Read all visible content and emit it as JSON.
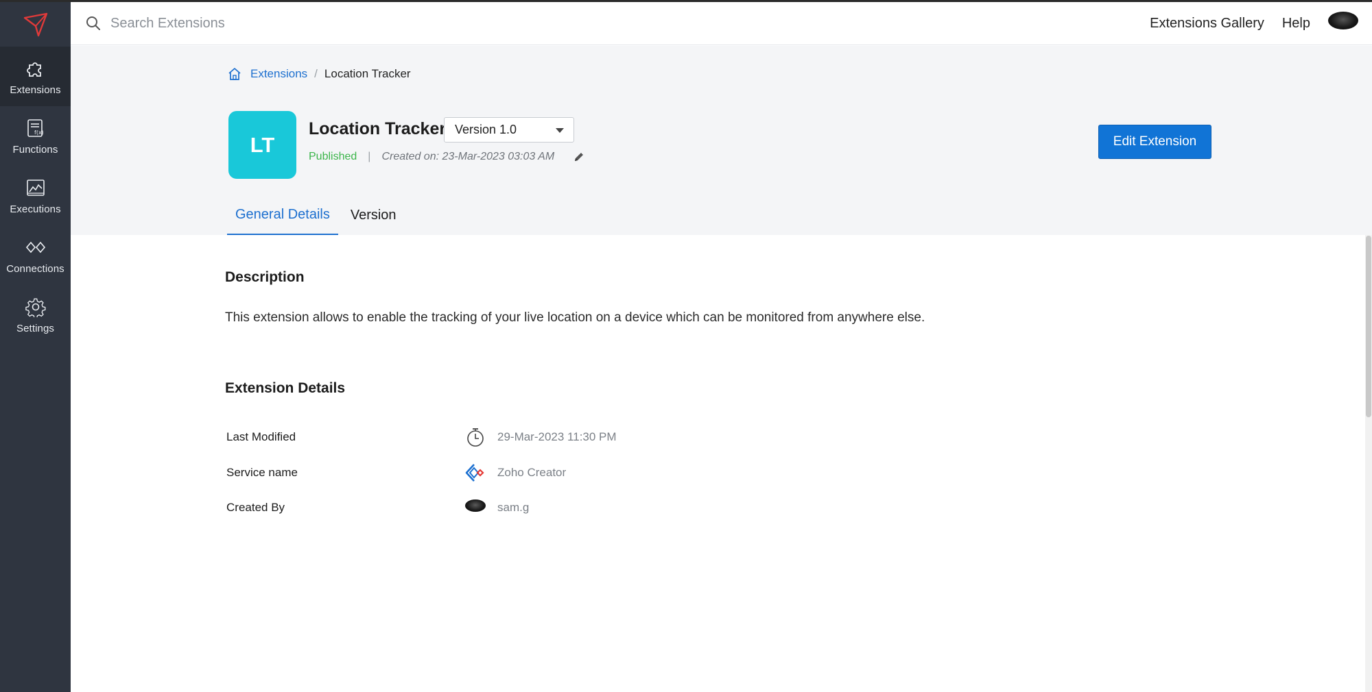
{
  "sidebar": {
    "logo_icon": "creator-arrow-logo",
    "items": [
      {
        "label": "Extensions",
        "icon": "puzzle-icon",
        "active": true
      },
      {
        "label": "Functions",
        "icon": "function-icon",
        "active": false
      },
      {
        "label": "Executions",
        "icon": "executions-chart-icon",
        "active": false
      },
      {
        "label": "Connections",
        "icon": "connections-icon",
        "active": false
      },
      {
        "label": "Settings",
        "icon": "gear-icon",
        "active": false
      }
    ]
  },
  "topbar": {
    "search_placeholder": "Search Extensions",
    "links": {
      "gallery": "Extensions Gallery",
      "help": "Help"
    }
  },
  "breadcrumb": {
    "parent": "Extensions",
    "separator": "/",
    "current": "Location Tracker"
  },
  "extension": {
    "initials": "LT",
    "title": "Location Tracker",
    "version": "Version 1.0",
    "status": "Published",
    "meta_separator": "|",
    "created": "Created on: 23-Mar-2023 03:03 AM",
    "edit_button": "Edit Extension"
  },
  "tabs": [
    {
      "label": "General Details",
      "active": true
    },
    {
      "label": "Version",
      "active": false
    }
  ],
  "description": {
    "title": "Description",
    "text": "This extension allows to enable the tracking of your live location on a device which can be monitored from anywhere else."
  },
  "details": {
    "title": "Extension Details",
    "rows": [
      {
        "label": "Last Modified",
        "icon": "stopwatch-icon",
        "value": "29-Mar-2023 11:30 PM"
      },
      {
        "label": "Service name",
        "icon": "zoho-creator-icon",
        "value": "Zoho Creator"
      },
      {
        "label": "Created By",
        "icon": "user-avatar",
        "value": "sam.g"
      }
    ]
  },
  "colors": {
    "sidebar": "#2f3540",
    "accent": "#1174d6",
    "logo_tile": "#19c8d9",
    "published": "#3bb54a"
  }
}
